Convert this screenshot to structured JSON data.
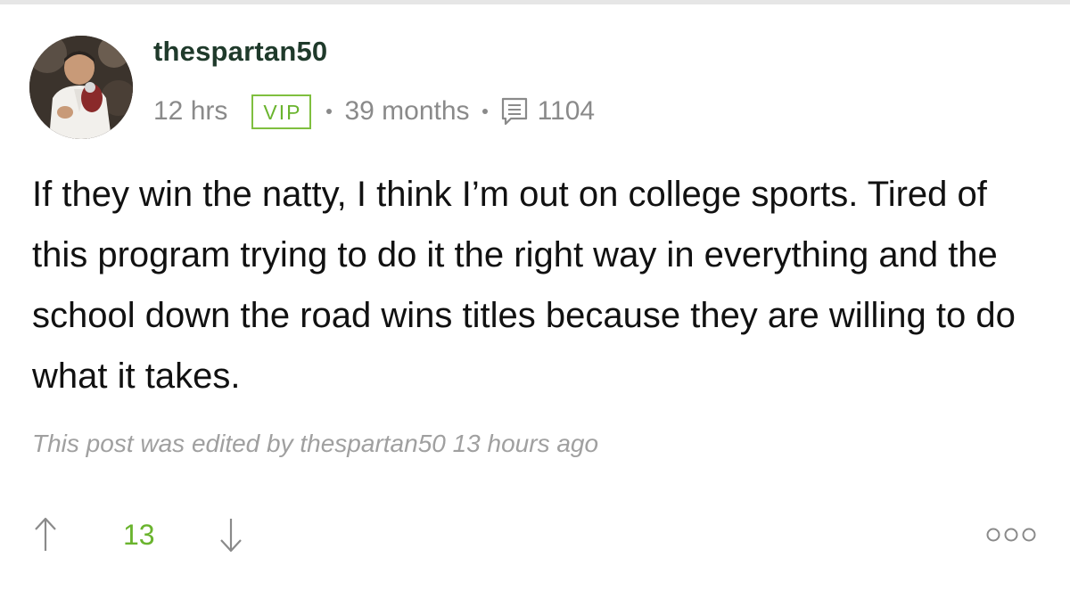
{
  "post": {
    "username": "thespartan50",
    "time": "12 hrs",
    "badge": "VIP",
    "tenure": "39 months",
    "post_count": "1104",
    "body": "If they win the natty, I think I’m out on college sports. Tired of this program trying to do it the right way in everything and the school down the road wins titles because they are willing to do what it takes.",
    "edited_note": "This post was edited by thespartan50 13 hours ago",
    "score": "13"
  },
  "icons": {
    "upvote": "arrow-up-icon",
    "downvote": "arrow-down-icon",
    "posts": "message-count-icon",
    "more": "more-options-icon"
  },
  "colors": {
    "username": "#1f3a2b",
    "accent_green": "#6ab42e",
    "meta_gray": "#8a8a8a",
    "edited_gray": "#a0a0a0",
    "body_text": "#111111"
  }
}
